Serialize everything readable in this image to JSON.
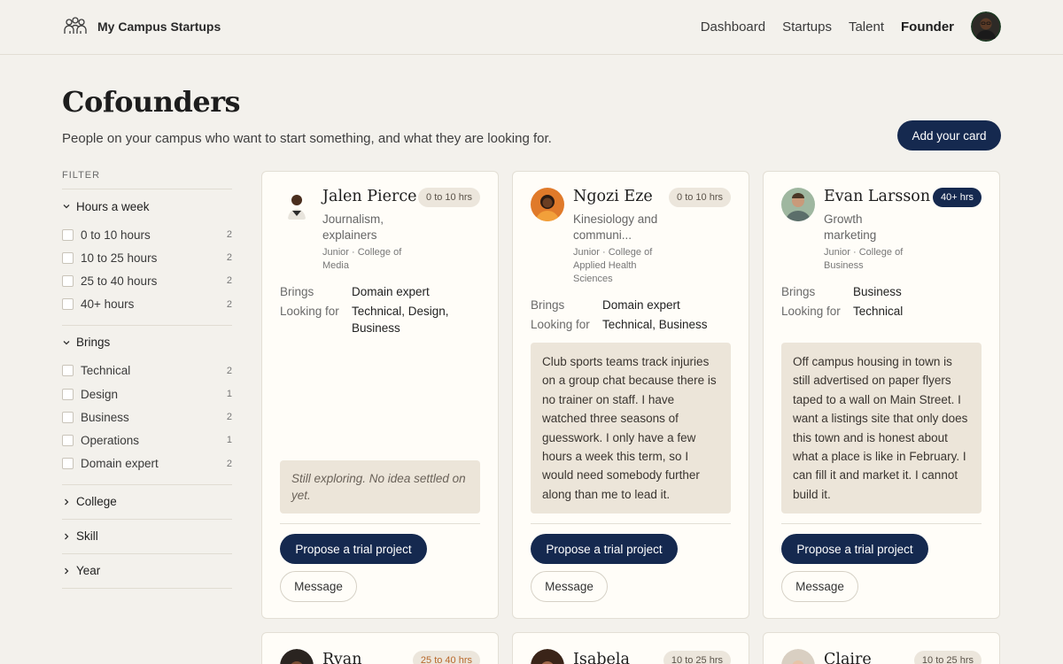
{
  "header": {
    "brand": "My Campus Startups",
    "nav": [
      "Dashboard",
      "Startups",
      "Talent",
      "Founder"
    ],
    "active_nav": "Founder"
  },
  "page": {
    "title": "Cofounders",
    "subtitle": "People on your campus who want to start something, and what they are looking for.",
    "add_button": "Add your card"
  },
  "filters": {
    "label": "FILTER",
    "groups": [
      {
        "title": "Hours a week",
        "expanded": true,
        "items": [
          {
            "label": "0 to 10 hours",
            "count": "2"
          },
          {
            "label": "10 to 25 hours",
            "count": "2"
          },
          {
            "label": "25 to 40 hours",
            "count": "2"
          },
          {
            "label": "40+ hours",
            "count": "2"
          }
        ]
      },
      {
        "title": "Brings",
        "expanded": true,
        "items": [
          {
            "label": "Technical",
            "count": "2"
          },
          {
            "label": "Design",
            "count": "1"
          },
          {
            "label": "Business",
            "count": "2"
          },
          {
            "label": "Operations",
            "count": "1"
          },
          {
            "label": "Domain expert",
            "count": "2"
          }
        ]
      },
      {
        "title": "College",
        "expanded": false
      },
      {
        "title": "Skill",
        "expanded": false
      },
      {
        "title": "Year",
        "expanded": false
      }
    ]
  },
  "labels": {
    "brings": "Brings",
    "looking_for": "Looking for",
    "propose": "Propose a trial project",
    "message": "Message"
  },
  "cards": [
    {
      "name": "Jalen Pierce",
      "badge": "0 to 10 hrs",
      "role": "Journalism, explainers",
      "meta": "Junior · College of Media",
      "brings": "Domain expert",
      "looking_for": "Technical, Design, Business",
      "pitch": "Still exploring. No idea settled on yet."
    },
    {
      "name": "Ngozi Eze",
      "badge": "0 to 10 hrs",
      "role": "Kinesiology and communi...",
      "meta": "Junior · College of Applied Health Sciences",
      "brings": "Domain expert",
      "looking_for": "Technical, Business",
      "pitch": "Club sports teams track injuries on a group chat because there is no trainer on staff. I have watched three seasons of guesswork. I only have a few hours a week this term, so I would need somebody further along than me to lead it."
    },
    {
      "name": "Evan Larsson",
      "badge": "40+ hrs",
      "role": "Growth marketing",
      "meta": "Junior · College of Business",
      "brings": "Business",
      "looking_for": "Technical",
      "pitch": "Off campus housing in town is still advertised on paper flyers taped to a wall on Main Street. I want a listings site that only does this town and is honest about what a place is like in February. I can fill it and market it. I cannot build it."
    },
    {
      "name": "Ryan",
      "badge": "25 to 40 hrs"
    },
    {
      "name": "Isabela",
      "badge": "10 to 25 hrs"
    },
    {
      "name": "Claire",
      "badge": "10 to 25 hrs"
    }
  ],
  "colors": {
    "accent": "#15294f",
    "background": "#f3f1ec",
    "card": "#fffdf8",
    "pitch": "#ece5d9"
  }
}
